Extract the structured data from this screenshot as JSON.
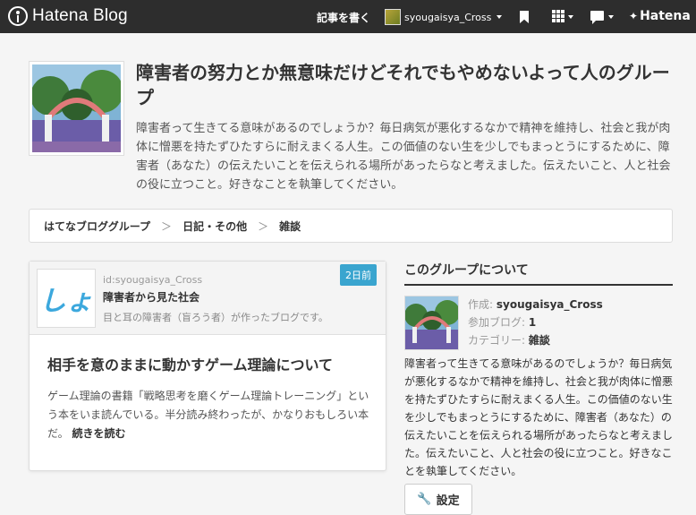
{
  "topbar": {
    "logo_text": "Hatena Blog",
    "write_label": "記事を書く",
    "username": "syougaisya_Cross",
    "hatena_text": "Hatena",
    "icons": [
      "bookmark-icon",
      "apps-grid-icon",
      "chat-icon",
      "hatena-star-icon"
    ]
  },
  "group": {
    "title": "障害者の努力とか無意味だけどそれでもやめないよって人のグループ",
    "description": "障害者って生きてる意味があるのでしょうか？毎日病気が悪化するなかで精神を維持し、社会と我が肉体に憎悪を持たずひたすらに耐えまくる人生。この価値のない生を少しでもまっとうにするために、障害者（あなた）の伝えたいことを伝えられる場所があったらなと考えました。伝えたいこと、人と社会の役に立つこと。好きなことを執筆してください。"
  },
  "breadcrumb": {
    "items": [
      "はてなブロググループ",
      "日記・その他",
      "雑談"
    ],
    "separator": "＞"
  },
  "entry": {
    "blog_icon_text": "しょ",
    "blog_id": "id:syougaisya_Cross",
    "blog_name": "障害者から見た社会",
    "blog_tagline": "目と耳の障害者（盲ろう者）が作ったブログです。",
    "date_badge": "2日前",
    "title": "相手を意のままに動かすゲーム理論について",
    "body": "ゲーム理論の書籍「戦略思考を磨くゲーム理論トレーニング」という本をいま読んでいる。半分読み終わったが、かなりおもしろい本だ。",
    "read_more": "続きを読む"
  },
  "sidebar": {
    "title": "このグループについて",
    "creator_key": "作成:",
    "creator_val": "syougaisya_Cross",
    "blogs_key": "参加ブログ:",
    "blogs_val": "1",
    "category_key": "カテゴリー:",
    "category_val": "雑談",
    "description": "障害者って生きてる意味があるのでしょうか？毎日病気が悪化するなかで精神を維持し、社会と我が肉体に憎悪を持たずひたすらに耐えまくる人生。この価値のない生を少しでもまっとうにするために、障害者（あなた）の伝えたいことを伝えられる場所があったらなと考えました。伝えたいこと、人と社会の役に立つこと。好きなことを執筆してください。",
    "settings_label": "設定"
  },
  "colors": {
    "topbar_bg": "#2d2d2d",
    "badge_bg": "#3aa5cf",
    "blog_icon_text": "#3ca8dd"
  }
}
